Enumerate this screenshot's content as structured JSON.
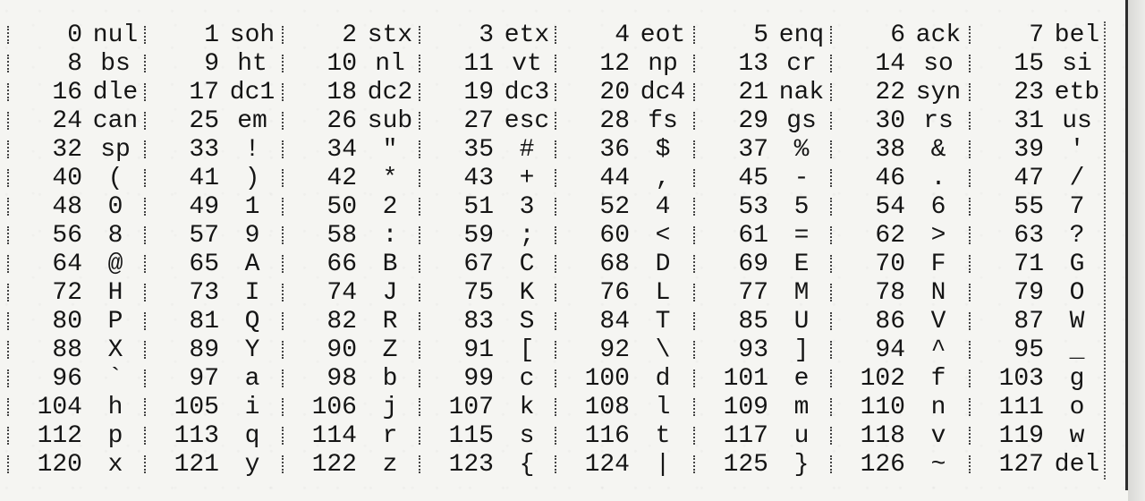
{
  "ascii_table": {
    "rows": [
      [
        [
          "0",
          "nul"
        ],
        [
          "1",
          "soh"
        ],
        [
          "2",
          "stx"
        ],
        [
          "3",
          "etx"
        ],
        [
          "4",
          "eot"
        ],
        [
          "5",
          "enq"
        ],
        [
          "6",
          "ack"
        ],
        [
          "7",
          "bel"
        ]
      ],
      [
        [
          "8",
          "bs"
        ],
        [
          "9",
          "ht"
        ],
        [
          "10",
          "nl"
        ],
        [
          "11",
          "vt"
        ],
        [
          "12",
          "np"
        ],
        [
          "13",
          "cr"
        ],
        [
          "14",
          "so"
        ],
        [
          "15",
          "si"
        ]
      ],
      [
        [
          "16",
          "dle"
        ],
        [
          "17",
          "dc1"
        ],
        [
          "18",
          "dc2"
        ],
        [
          "19",
          "dc3"
        ],
        [
          "20",
          "dc4"
        ],
        [
          "21",
          "nak"
        ],
        [
          "22",
          "syn"
        ],
        [
          "23",
          "etb"
        ]
      ],
      [
        [
          "24",
          "can"
        ],
        [
          "25",
          "em"
        ],
        [
          "26",
          "sub"
        ],
        [
          "27",
          "esc"
        ],
        [
          "28",
          "fs"
        ],
        [
          "29",
          "gs"
        ],
        [
          "30",
          "rs"
        ],
        [
          "31",
          "us"
        ]
      ],
      [
        [
          "32",
          "sp"
        ],
        [
          "33",
          "!"
        ],
        [
          "34",
          "\""
        ],
        [
          "35",
          "#"
        ],
        [
          "36",
          "$"
        ],
        [
          "37",
          "%"
        ],
        [
          "38",
          "&"
        ],
        [
          "39",
          "'"
        ]
      ],
      [
        [
          "40",
          "("
        ],
        [
          "41",
          ")"
        ],
        [
          "42",
          "*"
        ],
        [
          "43",
          "+"
        ],
        [
          "44",
          ","
        ],
        [
          "45",
          "-"
        ],
        [
          "46",
          "."
        ],
        [
          "47",
          "/"
        ]
      ],
      [
        [
          "48",
          "0"
        ],
        [
          "49",
          "1"
        ],
        [
          "50",
          "2"
        ],
        [
          "51",
          "3"
        ],
        [
          "52",
          "4"
        ],
        [
          "53",
          "5"
        ],
        [
          "54",
          "6"
        ],
        [
          "55",
          "7"
        ]
      ],
      [
        [
          "56",
          "8"
        ],
        [
          "57",
          "9"
        ],
        [
          "58",
          ":"
        ],
        [
          "59",
          ";"
        ],
        [
          "60",
          "<"
        ],
        [
          "61",
          "="
        ],
        [
          "62",
          ">"
        ],
        [
          "63",
          "?"
        ]
      ],
      [
        [
          "64",
          "@"
        ],
        [
          "65",
          "A"
        ],
        [
          "66",
          "B"
        ],
        [
          "67",
          "C"
        ],
        [
          "68",
          "D"
        ],
        [
          "69",
          "E"
        ],
        [
          "70",
          "F"
        ],
        [
          "71",
          "G"
        ]
      ],
      [
        [
          "72",
          "H"
        ],
        [
          "73",
          "I"
        ],
        [
          "74",
          "J"
        ],
        [
          "75",
          "K"
        ],
        [
          "76",
          "L"
        ],
        [
          "77",
          "M"
        ],
        [
          "78",
          "N"
        ],
        [
          "79",
          "O"
        ]
      ],
      [
        [
          "80",
          "P"
        ],
        [
          "81",
          "Q"
        ],
        [
          "82",
          "R"
        ],
        [
          "83",
          "S"
        ],
        [
          "84",
          "T"
        ],
        [
          "85",
          "U"
        ],
        [
          "86",
          "V"
        ],
        [
          "87",
          "W"
        ]
      ],
      [
        [
          "88",
          "X"
        ],
        [
          "89",
          "Y"
        ],
        [
          "90",
          "Z"
        ],
        [
          "91",
          "["
        ],
        [
          "92",
          "\\"
        ],
        [
          "93",
          "]"
        ],
        [
          "94",
          "^"
        ],
        [
          "95",
          "_"
        ]
      ],
      [
        [
          "96",
          "`"
        ],
        [
          "97",
          "a"
        ],
        [
          "98",
          "b"
        ],
        [
          "99",
          "c"
        ],
        [
          "100",
          "d"
        ],
        [
          "101",
          "e"
        ],
        [
          "102",
          "f"
        ],
        [
          "103",
          "g"
        ]
      ],
      [
        [
          "104",
          "h"
        ],
        [
          "105",
          "i"
        ],
        [
          "106",
          "j"
        ],
        [
          "107",
          "k"
        ],
        [
          "108",
          "l"
        ],
        [
          "109",
          "m"
        ],
        [
          "110",
          "n"
        ],
        [
          "111",
          "o"
        ]
      ],
      [
        [
          "112",
          "p"
        ],
        [
          "113",
          "q"
        ],
        [
          "114",
          "r"
        ],
        [
          "115",
          "s"
        ],
        [
          "116",
          "t"
        ],
        [
          "117",
          "u"
        ],
        [
          "118",
          "v"
        ],
        [
          "119",
          "w"
        ]
      ],
      [
        [
          "120",
          "x"
        ],
        [
          "121",
          "y"
        ],
        [
          "122",
          "z"
        ],
        [
          "123",
          "{"
        ],
        [
          "124",
          "|"
        ],
        [
          "125",
          "}"
        ],
        [
          "126",
          "~"
        ],
        [
          "127",
          "del"
        ]
      ]
    ]
  }
}
